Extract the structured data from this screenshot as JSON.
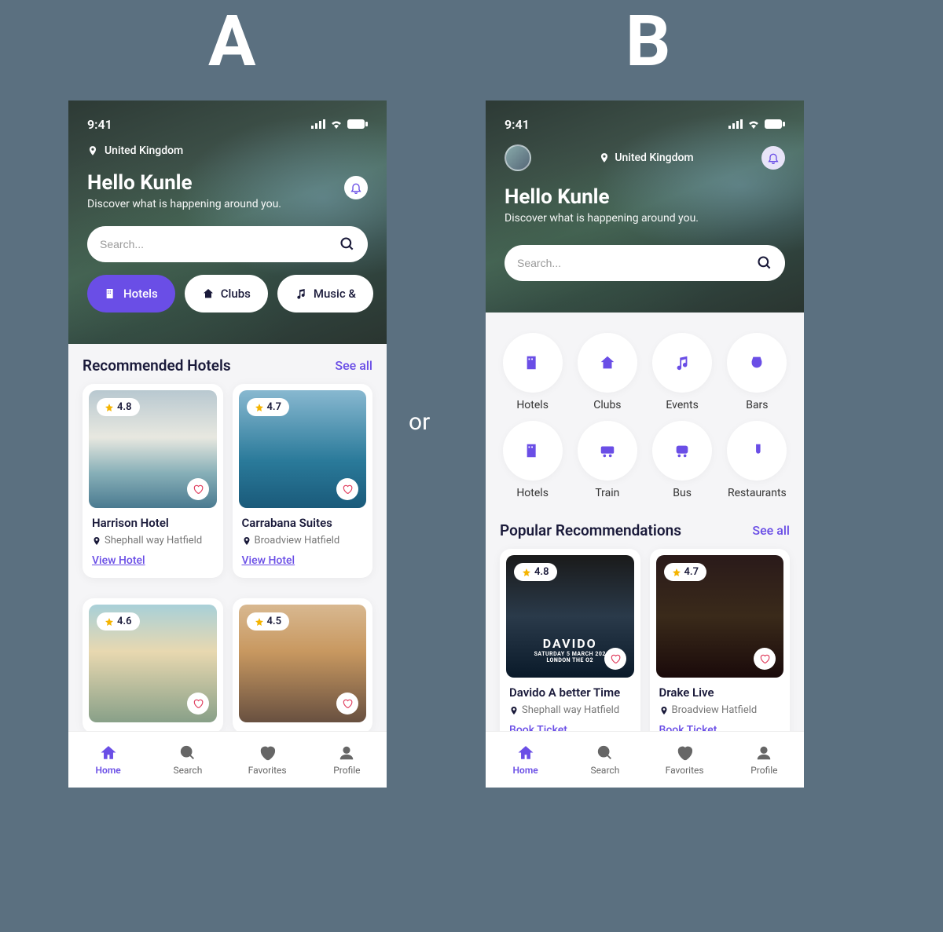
{
  "labels": {
    "A": "A",
    "B": "B",
    "or": "or"
  },
  "status": {
    "time": "9:41"
  },
  "location": "United Kingdom",
  "greeting": "Hello Kunle",
  "subtitle": "Discover what is happening around you.",
  "search": {
    "placeholder": "Search..."
  },
  "pills": [
    "Hotels",
    "Clubs",
    "Music &"
  ],
  "see_all": "See all",
  "bell_icon": "bell",
  "screenA": {
    "section_title": "Recommended Hotels",
    "cards": [
      {
        "rating": "4.8",
        "title": "Harrison Hotel",
        "loc": "Shephall way Hatfield",
        "link": "View Hotel"
      },
      {
        "rating": "4.7",
        "title": "Carrabana Suites",
        "loc": "Broadview Hatfield",
        "link": "View Hotel"
      },
      {
        "rating": "4.6"
      },
      {
        "rating": "4.5"
      }
    ]
  },
  "screenB": {
    "categories": [
      "Hotels",
      "Clubs",
      "Events",
      "Bars",
      "Hotels",
      "Train",
      "Bus",
      "Restaurants"
    ],
    "section_title": "Popular Recommendations",
    "cards": [
      {
        "rating": "4.8",
        "title": "Davido A better Time",
        "loc": "Shephall way Hatfield",
        "link": "Book Ticket",
        "poster_big": "DAVIDO",
        "poster_sm1": "SATURDAY 5 MARCH 202",
        "poster_sm2": "LONDON THE O2"
      },
      {
        "rating": "4.7",
        "title": "Drake Live",
        "loc": "Broadview Hatfield",
        "link": "Book Ticket"
      }
    ]
  },
  "nav": [
    "Home",
    "Search",
    "Favorites",
    "Profile"
  ]
}
